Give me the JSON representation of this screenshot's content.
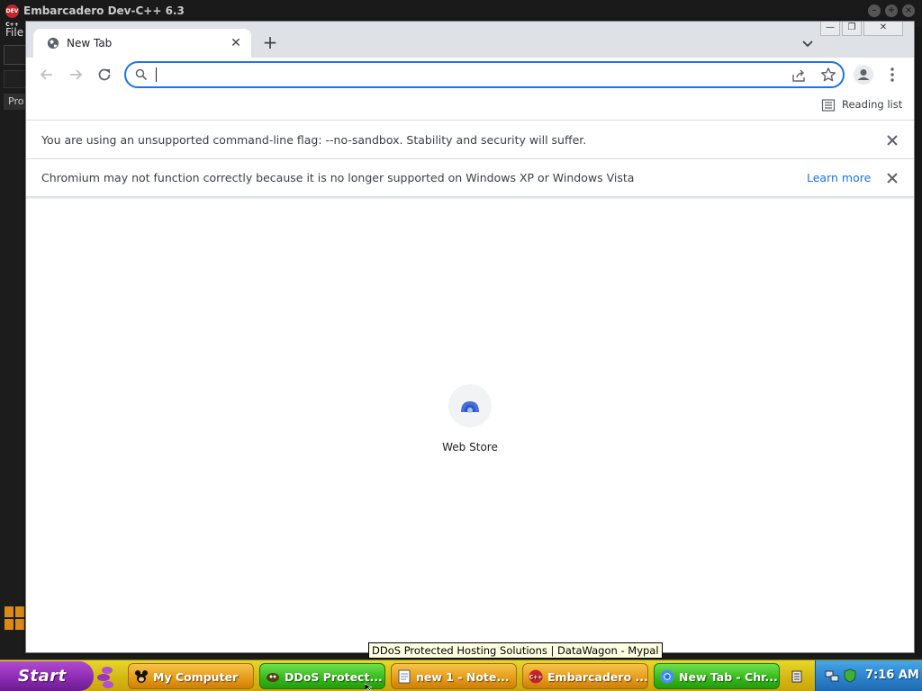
{
  "background_app": {
    "title": "Embarcadero Dev-C++ 6.3",
    "logo_text": "DEV C++",
    "menu_first": "File",
    "side_tab": "Pro"
  },
  "browser": {
    "tab": {
      "title": "New Tab"
    },
    "omnibox": {
      "value": "",
      "placeholder": ""
    },
    "bookmarks": {
      "reading_list": "Reading list"
    },
    "infobars": [
      {
        "text": "You are using an unsupported command-line flag: --no-sandbox. Stability and security will suffer."
      },
      {
        "text": "Chromium may not function correctly because it is no longer supported on Windows XP or Windows Vista",
        "link": "Learn more"
      }
    ],
    "shortcut": {
      "label": "Web Store"
    },
    "accent_color": "#1a73e8"
  },
  "tooltip": "DDoS Protected Hosting Solutions | DataWagon - Mypal",
  "taskbar": {
    "start_label": "Start",
    "tasks": [
      {
        "label": "My Computer",
        "icon": "mickey-icon",
        "active": false
      },
      {
        "label": "DDoS Protect...",
        "icon": "mypal-icon",
        "active": true
      },
      {
        "label": "new 1 - Note...",
        "icon": "notepad-icon",
        "active": false
      },
      {
        "label": "Embarcadero ...",
        "icon": "devcpp-icon",
        "active": false
      },
      {
        "label": "New Tab - Chr...",
        "icon": "chromium-icon",
        "active": true
      }
    ],
    "clock": "7:16 AM"
  }
}
